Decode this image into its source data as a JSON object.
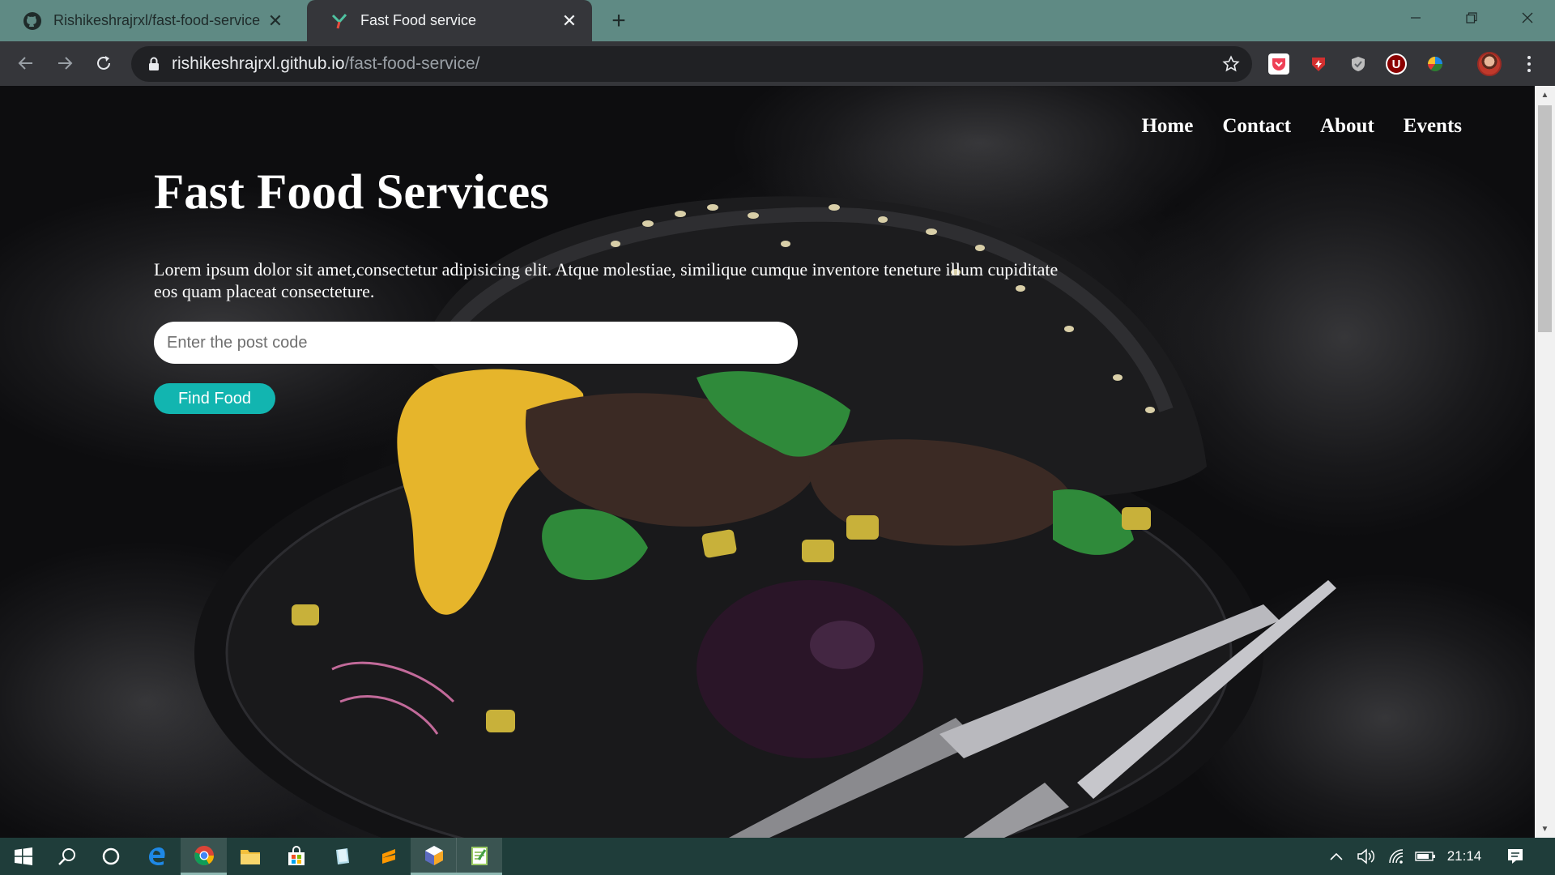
{
  "browser": {
    "tabs": [
      {
        "title": "Rishikeshrajrxl/fast-food-service",
        "icon": "github-icon",
        "active": false
      },
      {
        "title": "Fast Food service",
        "icon": "site-favicon-icon",
        "active": true
      }
    ],
    "url_host": "rishikeshrajrxl.github.io",
    "url_path": "/fast-food-service/",
    "extensions": [
      "pocket-icon",
      "red-extension-icon",
      "shield-extension-icon",
      "ublock-icon",
      "colorful-extension-icon"
    ]
  },
  "site": {
    "nav": [
      "Home",
      "Contact",
      "About",
      "Events"
    ],
    "hero": {
      "title": "Fast Food Services",
      "description": "Lorem ipsum dolor sit amet,consectetur adipisicing elit. Atque molestiae, similique cumque inventore teneture illum cupiditate eos quam placeat consecteture.",
      "postcode_placeholder": "Enter the post code",
      "button_label": "Find Food"
    },
    "colors": {
      "button": "#12b5b0",
      "text": "#ffffff"
    }
  },
  "taskbar": {
    "apps": [
      "windows-start-icon",
      "search-icon",
      "cortana-icon",
      "edge-icon",
      "chrome-icon",
      "file-explorer-icon",
      "store-icon",
      "notes-app-icon",
      "sublime-text-icon",
      "3d-app-icon",
      "notepad-icon"
    ],
    "clock": "21:14",
    "tray": [
      "chevron-up-icon",
      "volume-icon",
      "wifi-icon",
      "battery-icon",
      "notification-icon"
    ]
  }
}
